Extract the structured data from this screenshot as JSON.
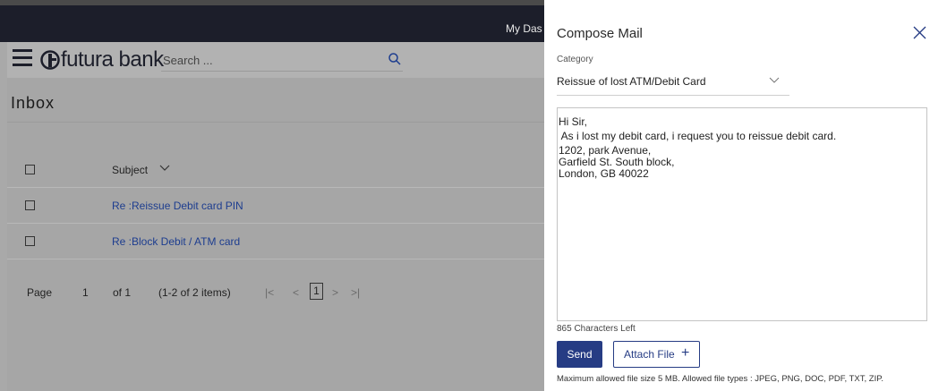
{
  "topbar": {
    "label": "My Das"
  },
  "header": {
    "brand_name": "futura bank",
    "search_placeholder": "Search ..."
  },
  "inbox": {
    "title": "Inbox",
    "column_subject": "Subject",
    "rows": [
      {
        "subject": "Re :Reissue Debit card PIN"
      },
      {
        "subject": "Re :Block Debit / ATM card"
      }
    ],
    "pager": {
      "page_label": "Page",
      "page_number": "1",
      "of_label": "of 1",
      "items_label": "(1-2 of 2 items)",
      "first_icon": "|<",
      "prev_icon": "<",
      "current_page": "1",
      "next_icon": ">",
      "last_icon": ">|"
    }
  },
  "compose": {
    "title": "Compose Mail",
    "category_label": "Category",
    "category_value": "Reissue of lost ATM/Debit Card",
    "message_lines": [
      "Hi Sir,",
      "",
      " As i lost my debit card, i request you to reissue debit card.",
      "",
      "1202, park Avenue,",
      "Garfield St. South block,",
      "London, GB 40022"
    ],
    "chars_left": "865 Characters Left",
    "send_label": "Send",
    "attach_label": "Attach File",
    "attach_plus": "+",
    "file_note": "Maximum allowed file size 5 MB. Allowed file types : JPEG, PNG, DOC, PDF, TXT, ZIP."
  },
  "colors": {
    "topbar": "#1c1e2a",
    "primary_button": "#263c84",
    "link": "#1d3d8f",
    "overlay_gray": "#a6a6a6"
  }
}
